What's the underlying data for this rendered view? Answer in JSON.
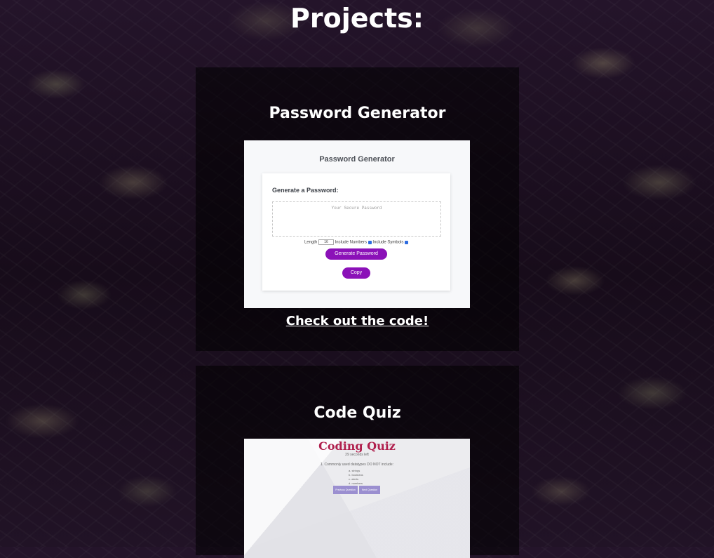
{
  "page": {
    "heading": "Projects:"
  },
  "projects": [
    {
      "title": "Password Generator",
      "link_text": "Check out the code!",
      "preview": {
        "title": "Password Generator",
        "subtitle": "Generate a Password:",
        "placeholder": "Your Secure Password",
        "length_label": "Length",
        "length_value": "16",
        "numbers_label": "Include Numbers",
        "symbols_label": "Include Symbols",
        "generate_label": "Generate Password",
        "copy_label": "Copy"
      }
    },
    {
      "title": "Code Quiz",
      "preview": {
        "title": "Coding Quiz",
        "timer": "29 seconds left",
        "question": "1. Commonly used datatypes DO NOT include:",
        "options": [
          "a. strings",
          "b. booleans",
          "c. alerts",
          "d. numbers"
        ],
        "prev_label": "Previous Question",
        "next_label": "Next Question"
      }
    }
  ],
  "colors": {
    "accent": "#8b11b8",
    "quiz_title": "#b01f4d",
    "quiz_button": "#9b8fd0"
  }
}
